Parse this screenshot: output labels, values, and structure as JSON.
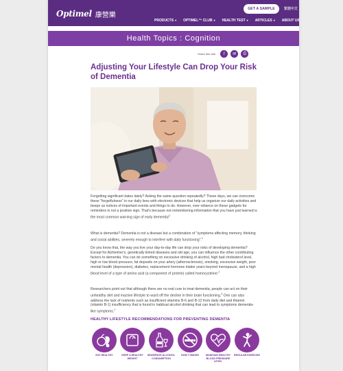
{
  "header": {
    "logo_text": "Optimel",
    "logo_cn": "康營樂",
    "sample_button": "GET A SAMPLE",
    "language": "繁體中文",
    "nav": [
      {
        "label": "PRODUCTS",
        "has_caret": true
      },
      {
        "label": "OPTIMEL™ CLUB",
        "has_caret": true
      },
      {
        "label": "HEALTH TEST",
        "has_caret": true
      },
      {
        "label": "ARTICLES",
        "has_caret": true
      },
      {
        "label": "ABOUT US",
        "has_caret": false
      }
    ]
  },
  "topic": {
    "label": "Health Topics : Cognition"
  },
  "share": {
    "label": "Share this with",
    "buttons": [
      {
        "name": "facebook-icon",
        "glyph": "f"
      },
      {
        "name": "email-icon",
        "glyph": "✉"
      },
      {
        "name": "print-icon",
        "glyph": "⎙"
      }
    ]
  },
  "article": {
    "title": "Adjusting Your Lifestyle Can Drop Your Risk of Dementia",
    "paragraphs": [
      {
        "text": "Forgetting significant dates lately? Asking the same question repeatedly? These days, we can overcome these \"forgetfulness\" in our daily lives with electronic devices that help us organize our daily activities and beeps us notices of important events and things to do. However, over-reliance on these gadgets for reminders is not a positive sign. That's because not remembering information that you have just learned is the most common warning sign of early dementia!",
        "ref": "1"
      },
      {
        "text": "What is dementia? Dementia is not a disease but a combination of \"symptoms affecting memory, thinking and social abilities, severely enough to interfere with daily functioning\".",
        "ref": "2"
      },
      {
        "text": "Do you know that, the way you live your day-to-day life can drop your risks of developing dementia? Except for Alzheimer's, genetically linked diseases and old age, you can influence the other contributing factors to dementia. You can do something on excessive drinking of alcohol, high bad cholesterol level, high or low blood pressure, fat deposits on your artery (atherosclerosis), smoking, excessive weight, poor mental health (depression), diabetes, replacement hormone intake years beyond menopause, and a high blood level of a type of amino acid (a component of protein) called homocysteine.",
        "ref": "2"
      },
      {
        "text": "Researchers point out that although there are no real cure to treat dementia, people can act on their unhealthy diet and inactive lifestyle to ward off the decline in their brain functioning.",
        "ref": "3",
        "text2": "One can also address the lack of nutrients such as insufficient vitamins B-6 and B-12 from daily diet and thiamin (vitamin B-1) insufficiency that is found in habitual alcohol drinking that can lead to symptoms dementia-like symptoms.",
        "ref2": "2"
      }
    ]
  },
  "recommendations": {
    "heading": "HEALTHY LIFESTYLE RECOMMENDATIONS FOR PREVENTING DEMENTIA",
    "items": [
      {
        "label": "EAT HEALTHY",
        "icon": "healthy-food-icon"
      },
      {
        "label": "KEEP A HEALTHY WEIGHT",
        "icon": "scale-icon"
      },
      {
        "label": "MODERATE ALCOHOL CONSUMPTION",
        "icon": "wine-bottle-icon"
      },
      {
        "label": "DON'T SMOKE",
        "icon": "no-smoking-icon"
      },
      {
        "label": "MAINTAIN HEALTHY BLOOD PRESSURE LEVEL",
        "icon": "heart-pulse-icon"
      },
      {
        "label": "REGULAR EXERCISE",
        "icon": "exercise-icon"
      }
    ]
  },
  "colors": {
    "brand_purple": "#5a2d82",
    "banner_purple": "#7e3fa4",
    "accent_purple": "#6a2f90",
    "icon_purple": "#8a3a9e"
  }
}
